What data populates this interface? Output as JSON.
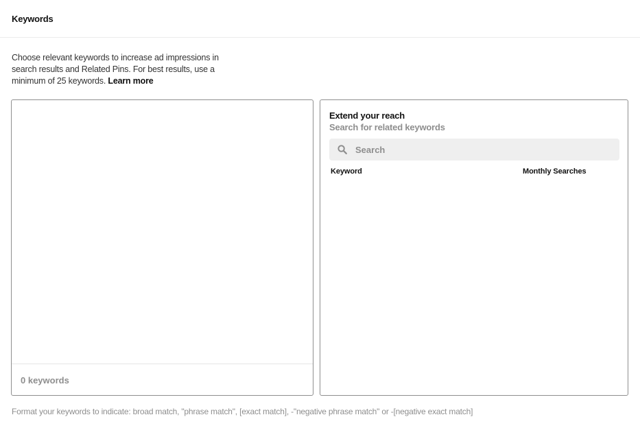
{
  "header": {
    "title": "Keywords"
  },
  "intro": {
    "text": "Choose relevant keywords to increase ad impressions in search results and Related Pins. For best results, use a minimum of 25 keywords.",
    "learn_more": "Learn more"
  },
  "keywords_panel": {
    "input_value": "",
    "count_label": "0 keywords"
  },
  "reach_panel": {
    "title": "Extend your reach",
    "subtitle": "Search for related keywords",
    "search": {
      "placeholder": "Search",
      "value": "",
      "icon": "search-icon"
    },
    "columns": [
      "Keyword",
      "Monthly Searches"
    ],
    "rows": []
  },
  "footer": {
    "format_hint": "Format your keywords to indicate: broad match, \"phrase match\", [exact match], -\"negative phrase match\" or -[negative exact match]"
  },
  "colors": {
    "border": "#8e8e8e",
    "muted_text": "#8e8e8e",
    "search_bg": "#efefef",
    "divider": "#ececec"
  }
}
